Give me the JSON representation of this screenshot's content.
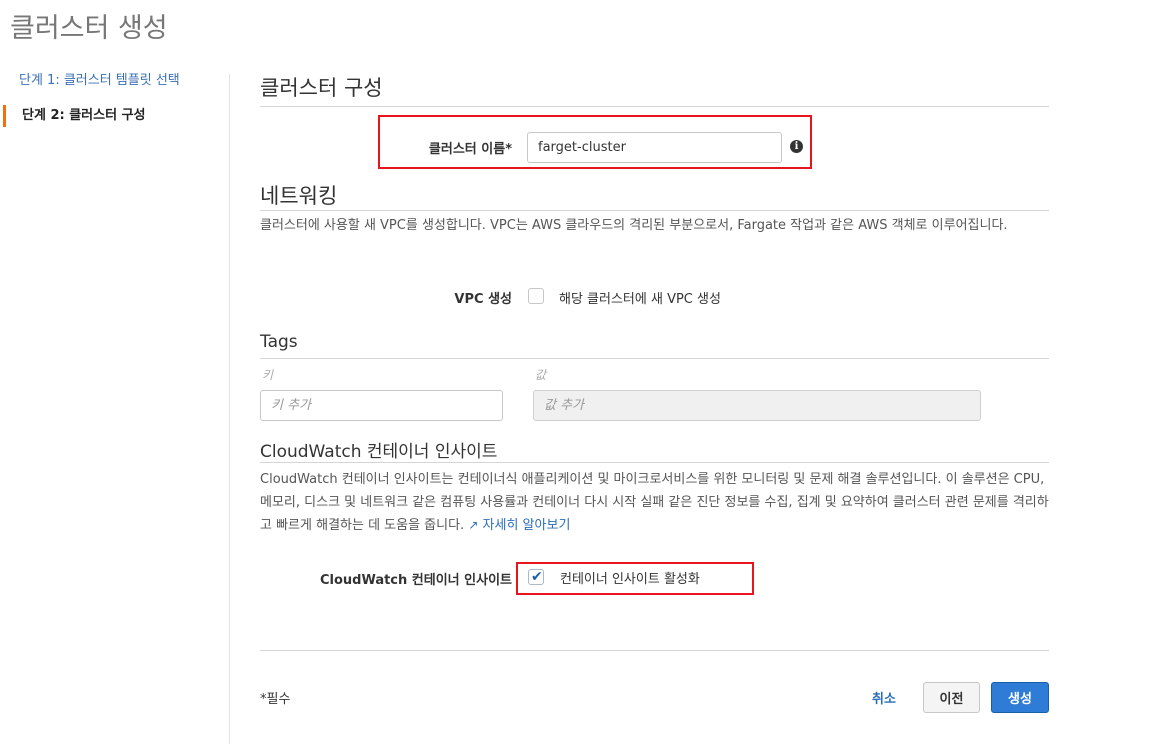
{
  "page": {
    "title": "클러스터 생성"
  },
  "steps": [
    {
      "label": "단계 1: 클러스터 템플릿 선택"
    },
    {
      "label": "단계 2: 클러스터 구성"
    }
  ],
  "cluster_config": {
    "heading": "클러스터 구성",
    "name_label": "클러스터 이름*",
    "name_value": "farget-cluster",
    "info_glyph": "i"
  },
  "networking": {
    "heading": "네트워킹",
    "description": "클러스터에 사용할 새 VPC를 생성합니다. VPC는 AWS 클라우드의 격리된 부분으로서, Fargate 작업과 같은 AWS 객체로 이루어집니다.",
    "vpc_label": "VPC 생성",
    "vpc_checkbox_label": "해당 클러스터에 새 VPC 생성",
    "vpc_checked": false
  },
  "tags": {
    "heading": "Tags",
    "key_label": "키",
    "value_label": "값",
    "key_placeholder": "키 추가",
    "value_placeholder": "값 추가"
  },
  "cloudwatch": {
    "heading": "CloudWatch 컨테이너 인사이트",
    "description": "CloudWatch 컨테이너 인사이트는 컨테이너식 애플리케이션 및 마이크로서비스를 위한 모니터링 및 문제 해결 솔루션입니다. 이 솔루션은 CPU, 메모리, 디스크 및 네트워크 같은 컴퓨팅 사용률과 컨테이너 다시 시작 실패 같은 진단 정보를 수집, 집계 및 요약하여 클러스터 관련 문제를 격리하고 빠르게 해결하는 데 도움을 줍니다.",
    "learn_more": "자세히 알아보기",
    "field_label": "CloudWatch 컨테이너 인사이트",
    "checkbox_label": "컨테이너 인사이트 활성화",
    "checked": true
  },
  "footer": {
    "required_note": "*필수",
    "cancel_label": "취소",
    "prev_label": "이전",
    "create_label": "생성"
  },
  "colors": {
    "accent_step": "#ec7211",
    "primary_button": "#2e7cd6",
    "link": "#2a6ebb",
    "highlight_box": "#e8141e"
  }
}
